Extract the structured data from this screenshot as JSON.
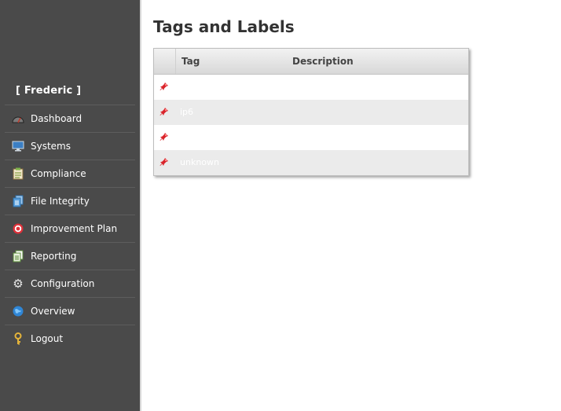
{
  "sidebar": {
    "user": "[ Frederic ]",
    "items": [
      {
        "label": "Dashboard",
        "icon": "dashboard-icon"
      },
      {
        "label": "Systems",
        "icon": "monitor-icon"
      },
      {
        "label": "Compliance",
        "icon": "clipboard-icon"
      },
      {
        "label": "File Integrity",
        "icon": "files-icon"
      },
      {
        "label": "Improvement Plan",
        "icon": "target-icon"
      },
      {
        "label": "Reporting",
        "icon": "report-icon"
      },
      {
        "label": "Configuration",
        "icon": "gear-icon"
      },
      {
        "label": "Overview",
        "icon": "globe-icon"
      },
      {
        "label": "Logout",
        "icon": "key-icon"
      }
    ]
  },
  "main": {
    "title": "Tags and Labels",
    "table": {
      "columns": [
        "Tag",
        "Description"
      ],
      "rows": [
        {
          "tag": "",
          "description": ""
        },
        {
          "tag": "ip6",
          "description": ""
        },
        {
          "tag": "",
          "description": ""
        },
        {
          "tag": "unknown",
          "description": ""
        }
      ]
    }
  }
}
